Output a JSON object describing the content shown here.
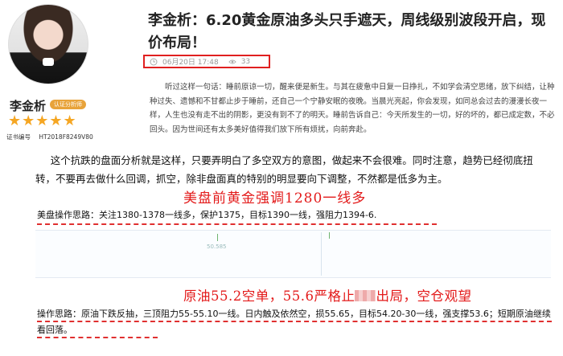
{
  "profile": {
    "name": "李金析",
    "badge": "认证分析师",
    "stars": "★★★★★",
    "cert_label": "证书编号",
    "cert_number": "HT2018F8249V80"
  },
  "article": {
    "title": "李金析：6.20黄金原油多头只手遮天，周线级别波段开启，现价布局！",
    "date": "06月20日 17:48",
    "views": "33",
    "intro": "听过这样一句话：睡前原谅一切，醒来便是新生。与其在疲惫中日复一日挣扎，不如学会清空思绪，放下纠结，让种种过失、遗憾和不甘都止步于睡前，还自己一个宁静安眠的夜晚。当晨光亮起，你会发现，如同总会过去的漫漫长夜一样，人生也没有走不出的阴影，更没有到不了的明天。睡前告诉自己：今天所发生的一切，好的坏的，都已成定数，不必回头。因为世间还有太多美好值得我们放下所有烦扰，向前奔赴。"
  },
  "analysis": "这个抗跌的盘面分析就是这样，只要弄明白了多空双方的意图，做起来不会很难。同时注意，趋势已经彻底扭转，不要再去做什么回调，抓空，除非盘面真的特别的明显要向下调整，不然都是低多为主。",
  "gold": {
    "headline": "美盘前黄金强调1280一线多",
    "operation": "美盘操作思路：关注1380-1378一线多，保护1375，目标1390一线，强阻力1394-6."
  },
  "chart": {
    "price_label": "50.585"
  },
  "oil": {
    "headline_a": "原油55.2空单，55.6严格止",
    "headline_b": "出局，空仓观望",
    "operation": "操作思路：原油下跌反抽，三顶阻力55-55.10一线。日内触及依然空，损55.65，目标54.20-30一线，强支撑53.6；短期原油继续看回落。"
  },
  "colors": {
    "accent_red": "#e31a1a",
    "star": "#f5a623"
  },
  "icons": [
    "clock-icon",
    "eye-icon"
  ]
}
